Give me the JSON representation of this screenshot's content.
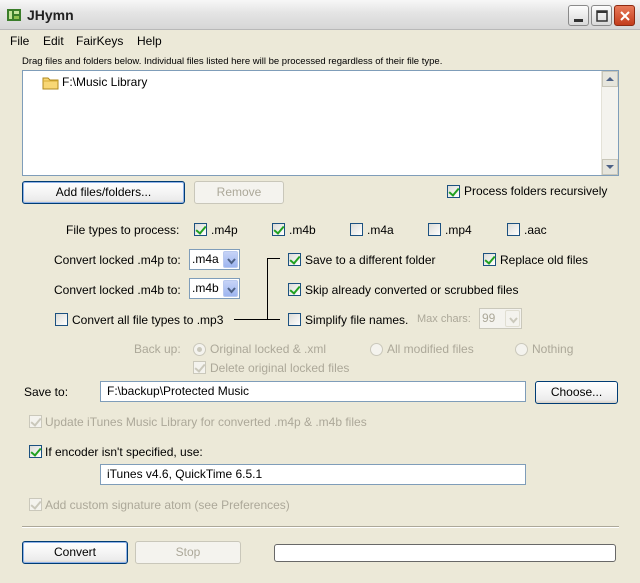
{
  "window": {
    "title": "JHymn"
  },
  "menu": [
    "File",
    "Edit",
    "FairKeys",
    "Help"
  ],
  "drop_hint": "Drag files and folders below. Individual files listed here will be processed regardless of their file type.",
  "file_list": [
    "F:\\Music Library"
  ],
  "buttons": {
    "add": "Add files/folders...",
    "remove": "Remove",
    "choose": "Choose...",
    "convert": "Convert",
    "stop": "Stop"
  },
  "process_recursive": {
    "label": "Process folders recursively",
    "checked": true
  },
  "file_types": {
    "label": "File types to process:",
    "items": [
      {
        "label": ".m4p",
        "checked": true
      },
      {
        "label": ".m4b",
        "checked": true
      },
      {
        "label": ".m4a",
        "checked": false
      },
      {
        "label": ".mp4",
        "checked": false
      },
      {
        "label": ".aac",
        "checked": false
      }
    ]
  },
  "convert_m4p": {
    "label": "Convert locked .m4p to:",
    "value": ".m4a"
  },
  "convert_m4b": {
    "label": "Convert locked .m4b to:",
    "value": ".m4b"
  },
  "convert_all_mp3": {
    "label": "Convert all file types to .mp3",
    "checked": false
  },
  "save_different_folder": {
    "label": "Save to a different folder",
    "checked": true
  },
  "replace_old": {
    "label": "Replace old files",
    "checked": true
  },
  "skip_converted": {
    "label": "Skip already converted or scrubbed files",
    "checked": true
  },
  "simplify_names": {
    "label": "Simplify file names.",
    "checked": false
  },
  "max_chars": {
    "label": "Max chars:",
    "value": "99"
  },
  "backup": {
    "label": "Back up:",
    "options": [
      "Original locked & .xml",
      "All modified files",
      "Nothing"
    ],
    "selected": "Original locked & .xml"
  },
  "delete_original": {
    "label": "Delete original locked files",
    "checked": true
  },
  "save_to": {
    "label": "Save to:",
    "value": "F:\\backup\\Protected Music"
  },
  "update_itunes": {
    "label": "Update iTunes Music Library for converted .m4p & .m4b files",
    "checked": true
  },
  "encoder": {
    "label": "If encoder isn't specified, use:",
    "checked": true,
    "value": "iTunes v4.6, QuickTime 6.5.1"
  },
  "signature": {
    "label": "Add custom signature atom (see Preferences)",
    "checked": true
  },
  "progress": {
    "fraction": 0.0
  },
  "colors": {
    "window_bg": "#ece9d8",
    "field_border": "#7f9db9",
    "check_green": "#21a121",
    "disabled_text": "#aca899"
  }
}
